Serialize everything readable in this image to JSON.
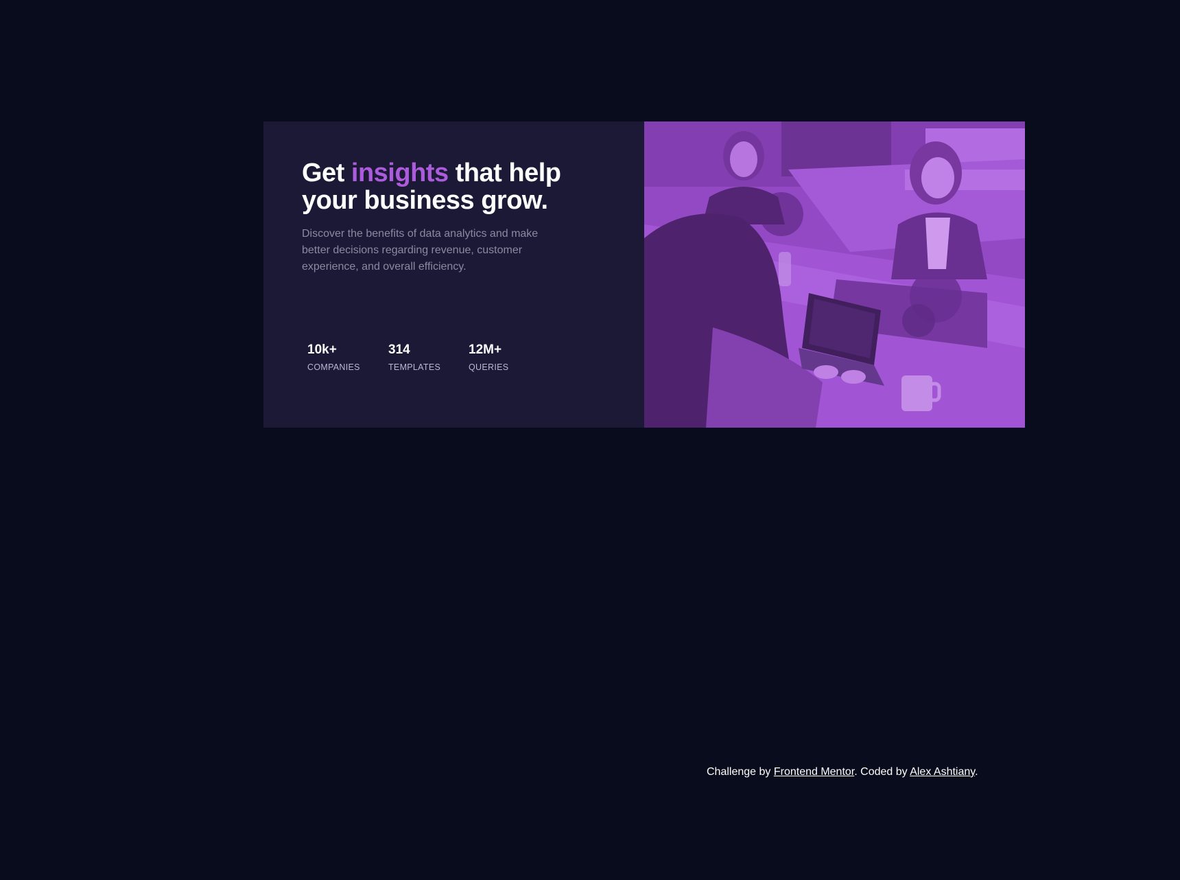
{
  "hero": {
    "headline_pre": "Get ",
    "headline_accent": "insights",
    "headline_post": " that help your business grow.",
    "description": "Discover the benefits of data analytics and make better decisions regarding revenue, customer experience, and overall efficiency."
  },
  "stats": [
    {
      "value": "10k+",
      "label": "COMPANIES"
    },
    {
      "value": "314",
      "label": "TEMPLATES"
    },
    {
      "value": "12M+",
      "label": "QUERIES"
    }
  ],
  "image": {
    "icon": "team-photo-image",
    "tint_color": "#aa5cdb"
  },
  "footer": {
    "prefix": "Challenge by ",
    "link1": "Frontend Mentor",
    "middle": ". Coded by ",
    "link2": "Alex Ashtiany",
    "suffix": "."
  },
  "colors": {
    "page_background": "#090c1c",
    "card_background": "#1b1936",
    "accent": "#aa5cdb",
    "description_text": "#8a8aa0"
  }
}
